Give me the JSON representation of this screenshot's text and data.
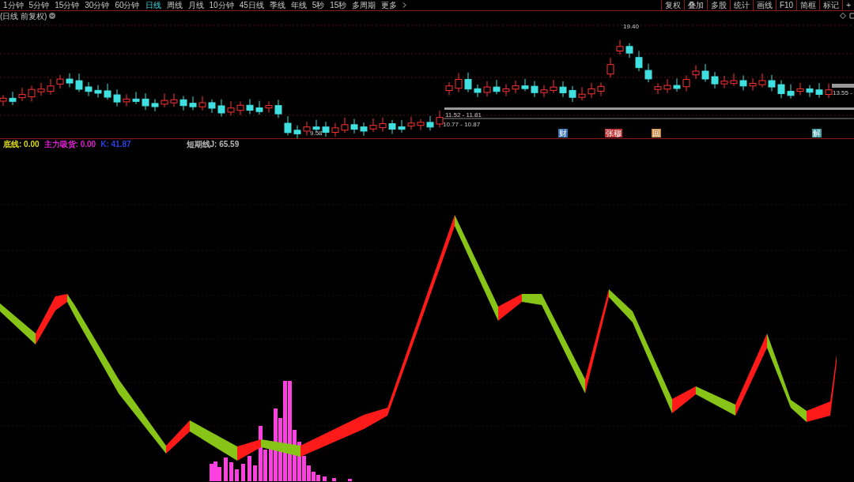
{
  "periods": [
    {
      "label": "1分钟",
      "selected": false
    },
    {
      "label": "5分钟",
      "selected": false
    },
    {
      "label": "15分钟",
      "selected": false
    },
    {
      "label": "30分钟",
      "selected": false
    },
    {
      "label": "60分钟",
      "selected": false
    },
    {
      "label": "日线",
      "selected": true
    },
    {
      "label": "周线",
      "selected": false
    },
    {
      "label": "月线",
      "selected": false
    },
    {
      "label": "10分钟",
      "selected": false
    },
    {
      "label": "45日线",
      "selected": false
    },
    {
      "label": "季线",
      "selected": false
    },
    {
      "label": "年线",
      "selected": false
    },
    {
      "label": "5秒",
      "selected": false
    },
    {
      "label": "15秒",
      "selected": false
    },
    {
      "label": "多周期",
      "selected": false
    }
  ],
  "more": "更多",
  "tools": [
    "复权",
    "叠加",
    "多股",
    "统计",
    "画线",
    "F10",
    "简框",
    "标记",
    "+"
  ],
  "subtitle": "(日线 前复权)",
  "price_labels": {
    "high": "19.40",
    "low": "9.58",
    "range_upper": "11.52 - 11.81",
    "range_lower": "10.77 - 10.87",
    "last": "13.55 -"
  },
  "event_markers": [
    {
      "label": "财",
      "color": "#3a6fb0"
    },
    {
      "label": "张穆",
      "color": "#c03030"
    },
    {
      "label": "回",
      "color": "#c88a40"
    },
    {
      "label": "解",
      "color": "#3a9aa0"
    }
  ],
  "indicators": [
    {
      "label": "底线: 0.00",
      "color": "#d8d820"
    },
    {
      "label": "主力吸货: 0.00",
      "color": "#e020d0"
    },
    {
      "label": "K: 41.87",
      "color": "#2a40e0"
    },
    {
      "label": "短期线J: 65.59",
      "color": "#b8b8b8"
    }
  ]
}
